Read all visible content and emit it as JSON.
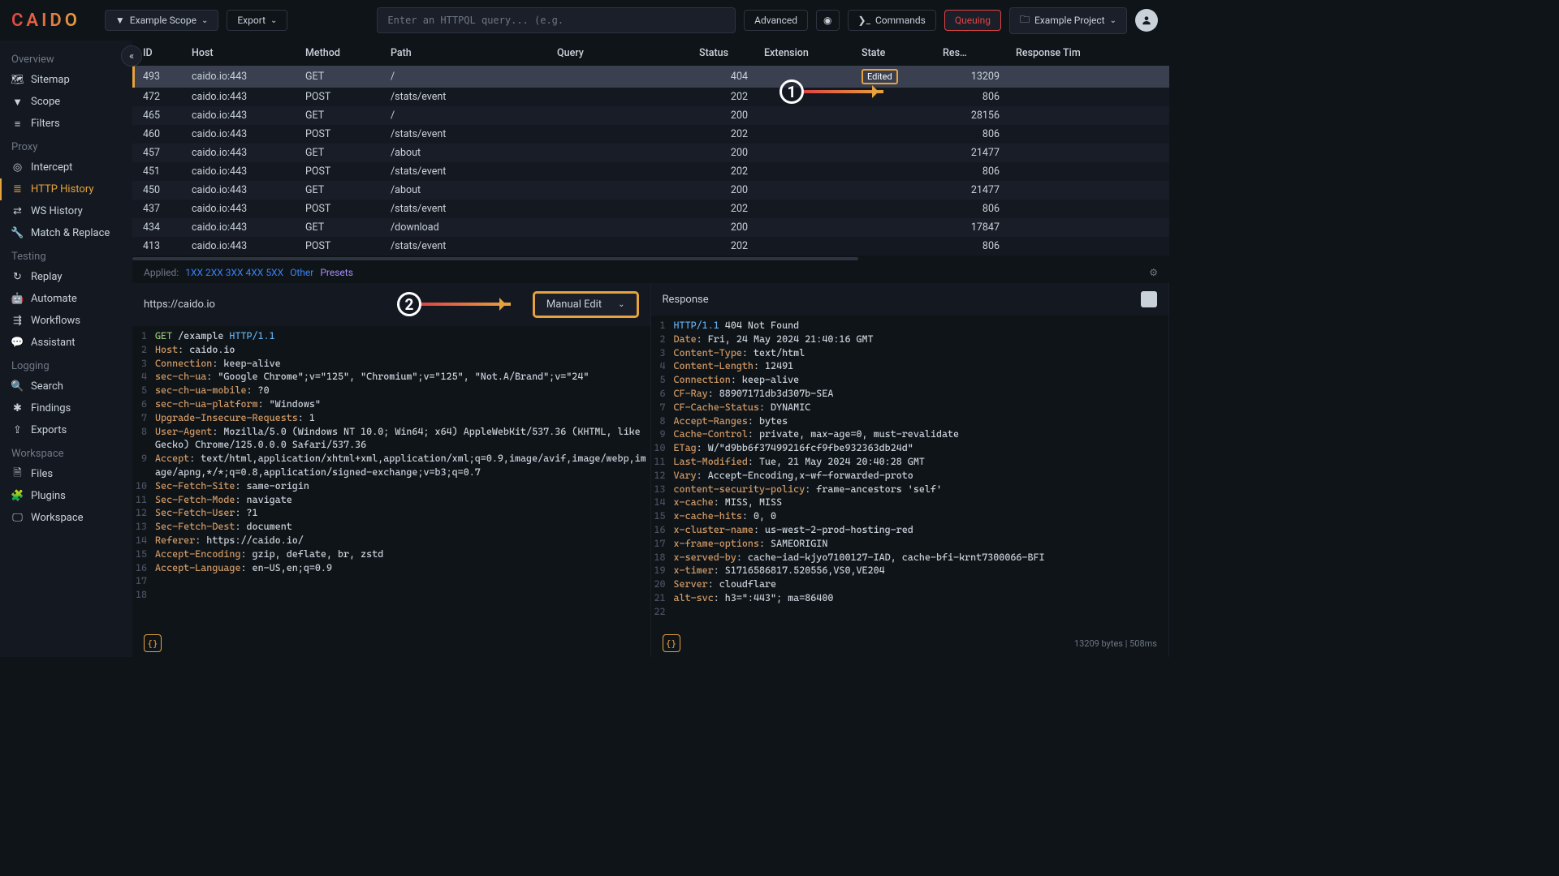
{
  "header": {
    "logo": "CAIDO",
    "scope": "Example Scope",
    "export": "Export",
    "search_placeholder": "Enter an HTTPQL query... (e.g.",
    "advanced": "Advanced",
    "commands": "Commands",
    "queuing": "Queuing",
    "project": "Example Project"
  },
  "sidebar": {
    "sections": [
      {
        "label": "Overview",
        "items": [
          {
            "icon": "sitemap",
            "label": "Sitemap"
          },
          {
            "icon": "funnel",
            "label": "Scope"
          },
          {
            "icon": "bars",
            "label": "Filters"
          }
        ]
      },
      {
        "label": "Proxy",
        "items": [
          {
            "icon": "target",
            "label": "Intercept"
          },
          {
            "icon": "list",
            "label": "HTTP History",
            "active": true
          },
          {
            "icon": "swap",
            "label": "WS History"
          },
          {
            "icon": "wrench",
            "label": "Match & Replace"
          }
        ]
      },
      {
        "label": "Testing",
        "items": [
          {
            "icon": "refresh",
            "label": "Replay"
          },
          {
            "icon": "robot",
            "label": "Automate"
          },
          {
            "icon": "workflow",
            "label": "Workflows"
          },
          {
            "icon": "chat",
            "label": "Assistant"
          }
        ]
      },
      {
        "label": "Logging",
        "items": [
          {
            "icon": "search",
            "label": "Search"
          },
          {
            "icon": "bug",
            "label": "Findings"
          },
          {
            "icon": "share",
            "label": "Exports"
          }
        ]
      },
      {
        "label": "Workspace",
        "items": [
          {
            "icon": "file",
            "label": "Files"
          },
          {
            "icon": "puzzle",
            "label": "Plugins"
          },
          {
            "icon": "monitor",
            "label": "Workspace"
          }
        ]
      }
    ]
  },
  "table": {
    "headers": [
      "ID",
      "Host",
      "Method",
      "Path",
      "Query",
      "Status",
      "Extension",
      "State",
      "Res…",
      "Response Tim"
    ],
    "rows": [
      {
        "id": "493",
        "host": "caido.io:443",
        "method": "GET",
        "path": "/",
        "status": "404",
        "state": "Edited",
        "res": "13209",
        "selected": true
      },
      {
        "id": "472",
        "host": "caido.io:443",
        "method": "POST",
        "path": "/stats/event",
        "status": "202",
        "res": "806"
      },
      {
        "id": "465",
        "host": "caido.io:443",
        "method": "GET",
        "path": "/",
        "status": "200",
        "res": "28156"
      },
      {
        "id": "460",
        "host": "caido.io:443",
        "method": "POST",
        "path": "/stats/event",
        "status": "202",
        "res": "806"
      },
      {
        "id": "457",
        "host": "caido.io:443",
        "method": "GET",
        "path": "/about",
        "status": "200",
        "res": "21477"
      },
      {
        "id": "451",
        "host": "caido.io:443",
        "method": "POST",
        "path": "/stats/event",
        "status": "202",
        "res": "806"
      },
      {
        "id": "450",
        "host": "caido.io:443",
        "method": "GET",
        "path": "/about",
        "status": "200",
        "res": "21477"
      },
      {
        "id": "437",
        "host": "caido.io:443",
        "method": "POST",
        "path": "/stats/event",
        "status": "202",
        "res": "806"
      },
      {
        "id": "434",
        "host": "caido.io:443",
        "method": "GET",
        "path": "/download",
        "status": "200",
        "res": "17847"
      },
      {
        "id": "413",
        "host": "caido.io:443",
        "method": "POST",
        "path": "/stats/event",
        "status": "202",
        "res": "806"
      }
    ]
  },
  "filters": {
    "applied": "Applied:",
    "codes": [
      "1XX",
      "2XX",
      "3XX",
      "4XX",
      "5XX"
    ],
    "other": "Other",
    "presets": "Presets"
  },
  "request": {
    "url": "https://caido.io",
    "dropdown": "Manual Edit",
    "lines": [
      [
        {
          "c": "green",
          "t": "GET"
        },
        {
          "c": "white",
          "t": " /example "
        },
        {
          "c": "blue",
          "t": "HTTP/1.1"
        }
      ],
      [
        {
          "c": "orange",
          "t": "Host"
        },
        {
          "c": "white",
          "t": ": caido.io"
        }
      ],
      [
        {
          "c": "orange",
          "t": "Connection"
        },
        {
          "c": "white",
          "t": ": keep-alive"
        }
      ],
      [
        {
          "c": "orange",
          "t": "sec-ch-ua"
        },
        {
          "c": "white",
          "t": ": \"Google Chrome\";v=\"125\", \"Chromium\";v=\"125\", \"Not.A/Brand\";v=\"24\""
        }
      ],
      [
        {
          "c": "orange",
          "t": "sec-ch-ua-mobile"
        },
        {
          "c": "white",
          "t": ": ?0"
        }
      ],
      [
        {
          "c": "orange",
          "t": "sec-ch-ua-platform"
        },
        {
          "c": "white",
          "t": ": \"Windows\""
        }
      ],
      [
        {
          "c": "orange",
          "t": "Upgrade-Insecure-Requests"
        },
        {
          "c": "white",
          "t": ": 1"
        }
      ],
      [
        {
          "c": "orange",
          "t": "User-Agent"
        },
        {
          "c": "white",
          "t": ": Mozilla/5.0 (Windows NT 10.0; Win64; x64) AppleWebKit/537.36 (KHTML, like Gecko) Chrome/125.0.0.0 Safari/537.36"
        }
      ],
      [
        {
          "c": "orange",
          "t": "Accept"
        },
        {
          "c": "white",
          "t": ": text/html,application/xhtml+xml,application/xml;q=0.9,image/avif,image/webp,image/apng,*/*;q=0.8,application/signed-exchange;v=b3;q=0.7"
        }
      ],
      [
        {
          "c": "orange",
          "t": "Sec-Fetch-Site"
        },
        {
          "c": "white",
          "t": ": same-origin"
        }
      ],
      [
        {
          "c": "orange",
          "t": "Sec-Fetch-Mode"
        },
        {
          "c": "white",
          "t": ": navigate"
        }
      ],
      [
        {
          "c": "orange",
          "t": "Sec-Fetch-User"
        },
        {
          "c": "white",
          "t": ": ?1"
        }
      ],
      [
        {
          "c": "orange",
          "t": "Sec-Fetch-Dest"
        },
        {
          "c": "white",
          "t": ": document"
        }
      ],
      [
        {
          "c": "orange",
          "t": "Referer"
        },
        {
          "c": "white",
          "t": ": https://caido.io/"
        }
      ],
      [
        {
          "c": "orange",
          "t": "Accept-Encoding"
        },
        {
          "c": "white",
          "t": ": gzip, deflate, br, zstd"
        }
      ],
      [
        {
          "c": "orange",
          "t": "Accept-Language"
        },
        {
          "c": "white",
          "t": ": en-US,en;q=0.9"
        }
      ],
      [],
      []
    ]
  },
  "response": {
    "title": "Response",
    "lines": [
      [
        {
          "c": "blue",
          "t": "HTTP/1.1"
        },
        {
          "c": "white",
          "t": " 404 Not Found"
        }
      ],
      [
        {
          "c": "orange",
          "t": "Date"
        },
        {
          "c": "white",
          "t": ": Fri, 24 May 2024 21:40:16 GMT"
        }
      ],
      [
        {
          "c": "orange",
          "t": "Content-Type"
        },
        {
          "c": "white",
          "t": ": text/html"
        }
      ],
      [
        {
          "c": "orange",
          "t": "Content-Length"
        },
        {
          "c": "white",
          "t": ": 12491"
        }
      ],
      [
        {
          "c": "orange",
          "t": "Connection"
        },
        {
          "c": "white",
          "t": ": keep-alive"
        }
      ],
      [
        {
          "c": "orange",
          "t": "CF-Ray"
        },
        {
          "c": "white",
          "t": ": 88907171db3d307b-SEA"
        }
      ],
      [
        {
          "c": "orange",
          "t": "CF-Cache-Status"
        },
        {
          "c": "white",
          "t": ": DYNAMIC"
        }
      ],
      [
        {
          "c": "orange",
          "t": "Accept-Ranges"
        },
        {
          "c": "white",
          "t": ": bytes"
        }
      ],
      [
        {
          "c": "orange",
          "t": "Cache-Control"
        },
        {
          "c": "white",
          "t": ": private, max-age=0, must-revalidate"
        }
      ],
      [
        {
          "c": "orange",
          "t": "ETag"
        },
        {
          "c": "white",
          "t": ": W/\"d9bb6f37499216fcf9fbe932363db24d\""
        }
      ],
      [
        {
          "c": "orange",
          "t": "Last-Modified"
        },
        {
          "c": "white",
          "t": ": Tue, 21 May 2024 20:40:28 GMT"
        }
      ],
      [
        {
          "c": "orange",
          "t": "Vary"
        },
        {
          "c": "white",
          "t": ": Accept-Encoding,x-wf-forwarded-proto"
        }
      ],
      [
        {
          "c": "orange",
          "t": "content-security-policy"
        },
        {
          "c": "white",
          "t": ": frame-ancestors 'self'"
        }
      ],
      [
        {
          "c": "orange",
          "t": "x-cache"
        },
        {
          "c": "white",
          "t": ": MISS, MISS"
        }
      ],
      [
        {
          "c": "orange",
          "t": "x-cache-hits"
        },
        {
          "c": "white",
          "t": ": 0, 0"
        }
      ],
      [
        {
          "c": "orange",
          "t": "x-cluster-name"
        },
        {
          "c": "white",
          "t": ": us-west-2-prod-hosting-red"
        }
      ],
      [
        {
          "c": "orange",
          "t": "x-frame-options"
        },
        {
          "c": "white",
          "t": ": SAMEORIGIN"
        }
      ],
      [
        {
          "c": "orange",
          "t": "x-served-by"
        },
        {
          "c": "white",
          "t": ": cache-iad-kjyo7100127-IAD, cache-bfi-krnt7300066-BFI"
        }
      ],
      [
        {
          "c": "orange",
          "t": "x-timer"
        },
        {
          "c": "white",
          "t": ": S1716586817.520556,VS0,VE204"
        }
      ],
      [
        {
          "c": "orange",
          "t": "Server"
        },
        {
          "c": "white",
          "t": ": cloudflare"
        }
      ],
      [
        {
          "c": "orange",
          "t": "alt-svc"
        },
        {
          "c": "white",
          "t": ": h3=\":443\"; ma=86400"
        }
      ],
      []
    ]
  },
  "footer": {
    "stats": "13209 bytes  |  508ms"
  },
  "annotations": {
    "one": "1",
    "two": "2"
  }
}
